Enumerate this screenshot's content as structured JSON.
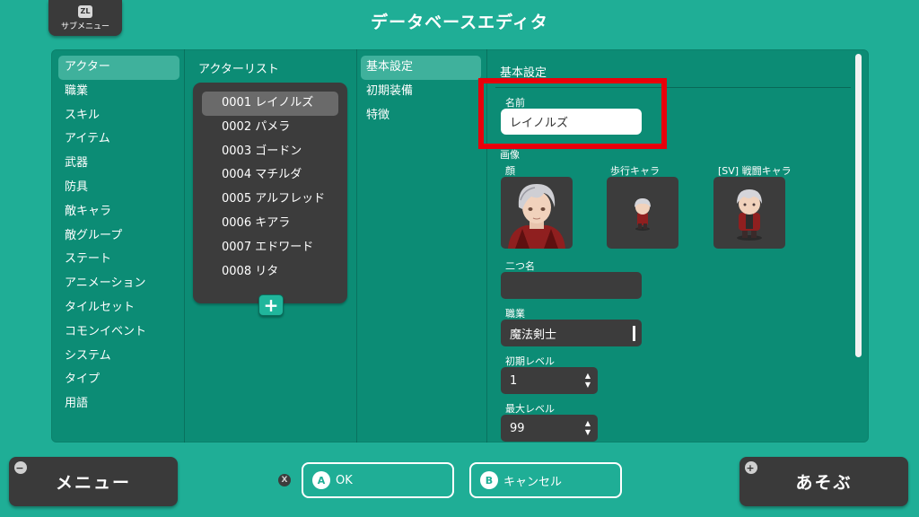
{
  "header": {
    "title": "データベースエディタ",
    "submenu_badge": "ZL",
    "submenu_label": "サブメニュー"
  },
  "categories": [
    {
      "label": "アクター",
      "selected": true
    },
    {
      "label": "職業"
    },
    {
      "label": "スキル"
    },
    {
      "label": "アイテム"
    },
    {
      "label": "武器"
    },
    {
      "label": "防具"
    },
    {
      "label": "敵キャラ"
    },
    {
      "label": "敵グループ"
    },
    {
      "label": "ステート"
    },
    {
      "label": "アニメーション"
    },
    {
      "label": "タイルセット"
    },
    {
      "label": "コモンイベント"
    },
    {
      "label": "システム"
    },
    {
      "label": "タイプ"
    },
    {
      "label": "用語"
    }
  ],
  "actor_list": {
    "title": "アクターリスト",
    "items": [
      {
        "label": "0001 レイノルズ",
        "selected": true
      },
      {
        "label": "0002 パメラ"
      },
      {
        "label": "0003 ゴードン"
      },
      {
        "label": "0004 マチルダ"
      },
      {
        "label": "0005 アルフレッド"
      },
      {
        "label": "0006 キアラ"
      },
      {
        "label": "0007 エドワード"
      },
      {
        "label": "0008 リタ"
      }
    ],
    "add_label": "+"
  },
  "tabs": [
    {
      "label": "基本設定",
      "selected": true
    },
    {
      "label": "初期装備"
    },
    {
      "label": "特徴"
    }
  ],
  "form": {
    "section_title": "基本設定",
    "name_label": "名前",
    "name_value": "レイノルズ",
    "image_label": "画像",
    "face_label": "顔",
    "walk_label": "歩行キャラ",
    "battle_label": "[SV] 戦闘キャラ",
    "nickname_label": "二つ名",
    "nickname_value": "",
    "class_label": "職業",
    "class_value": "魔法剣士",
    "initial_level_label": "初期レベル",
    "initial_level_value": "1",
    "max_level_label": "最大レベル",
    "max_level_value": "99"
  },
  "footer": {
    "menu_label": "メニュー",
    "menu_badge": "−",
    "play_label": "あそぶ",
    "play_badge": "+",
    "ok_badge": "A",
    "ok_label": "OK",
    "cancel_badge": "B",
    "cancel_label": "キャンセル",
    "x_badge": "X"
  },
  "colors": {
    "background": "#1fae96",
    "panel": "#0c8c75",
    "selected": "#3fb19c",
    "dark_box": "#3c3c3c",
    "highlight": "#e8000b"
  }
}
